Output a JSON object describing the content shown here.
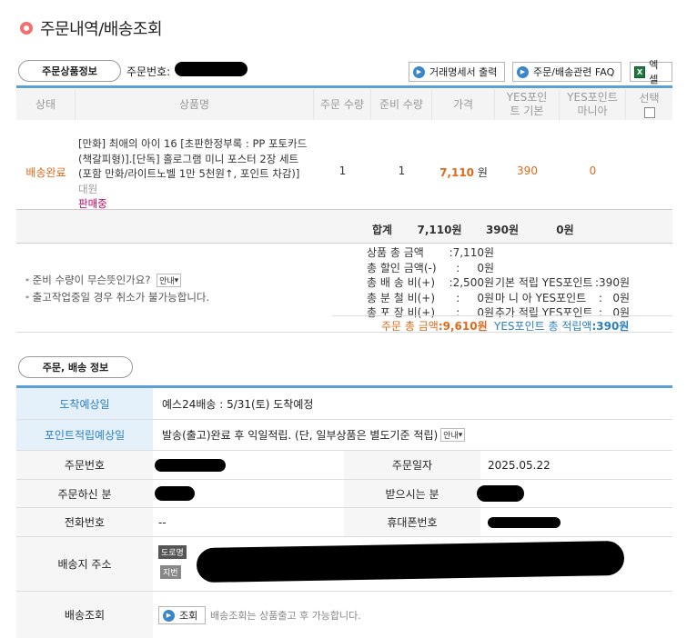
{
  "page_title": "주문내역/배송조회",
  "section1": {
    "tab_label": "주문상품정보",
    "order_no_label": "주문번호:",
    "buttons": {
      "receipt": "거래명세서 출력",
      "faq": "주문/배송관련 FAQ",
      "excel": "엑셀"
    }
  },
  "table": {
    "headers": {
      "status": "상태",
      "product": "상품명",
      "order_qty": "주문 수량",
      "prep_qty": "준비 수량",
      "price": "가격",
      "yes_basic": "YES포인트 기본",
      "yes_mania": "YES포인트 마니아",
      "select": "선택"
    },
    "row": {
      "status": "배송완료",
      "product_title": "[만화] 최애의 아이 16 [초판한정부록 : PP 포토카드 (책갈피형)].[단독] 홀로그램 미니 포스터 2장 세트 (포함 만화/라이트노벨 1만 5천원↑, 포인트 차감)]",
      "publisher": "대원",
      "sale_status": "판매중",
      "order_qty": "1",
      "prep_qty": "1",
      "price": "7,110",
      "price_unit": "원",
      "yes_basic": "390",
      "yes_mania": "0"
    },
    "total": {
      "label": "합계",
      "price": "7,110원",
      "basic": "390원",
      "mania": "0원"
    }
  },
  "notes": {
    "line1": "준비 수량이 무슨뜻인가요?",
    "guide": "안내",
    "line2": "출고작업중일 경우 취소가 불가능합니다."
  },
  "summary": {
    "left": [
      {
        "label": "상품 총 금액",
        "value": ":7,110원"
      },
      {
        "label": "총 할인 금액(-)",
        "value": ":     0원"
      },
      {
        "label": "총 배 송 비(+)",
        "value": ":2,500원"
      },
      {
        "label": "총 분 철 비(+)",
        "value": ":     0원"
      },
      {
        "label": "총 포 장 비(+)",
        "value": ":     0원"
      }
    ],
    "right": [
      {
        "label": "기본 적립 YES포인트",
        "value": ":390원"
      },
      {
        "label": "마 니 아 YES포인트",
        "value": ":   0원"
      },
      {
        "label": "추가 적립 YES포인트",
        "value": ":   0원"
      }
    ],
    "order_total_label": "주문 총 금액",
    "order_total_value": ":9,610원",
    "point_total_label": "YES포인트 총 적립액",
    "point_total_value": ":390원"
  },
  "section2": {
    "tab_label": "주문, 배송 정보",
    "eta_label": "도착예상일",
    "eta_value": "예스24배송 : 5/31(토) 도착예정",
    "point_label": "포인트적립예상일",
    "point_value": "발송(출고)완료 후 익일적립. (단, 일부상품은 별도기준 적립)",
    "order_no": "주문번호",
    "order_date_label": "주문일자",
    "order_date": "2025.05.22",
    "orderer": "주문하신 분",
    "receiver": "받으시는 분",
    "phone": "전화번호",
    "phone_value": "--",
    "mobile": "휴대폰번호",
    "address": "배송지 주소",
    "road_tag": "도로명",
    "lot_tag": "지번",
    "tracking": "배송조회",
    "track_btn": "조회",
    "track_note": "배송조회는 상품출고 후 가능합니다."
  },
  "colors": {
    "accent_blue": "#5aa0d6",
    "status_orange": "#e06a1b",
    "sale_red": "#c0005f",
    "eta_header_bg": "#e4f1fa",
    "eta_header_text": "#2d7fc1"
  }
}
